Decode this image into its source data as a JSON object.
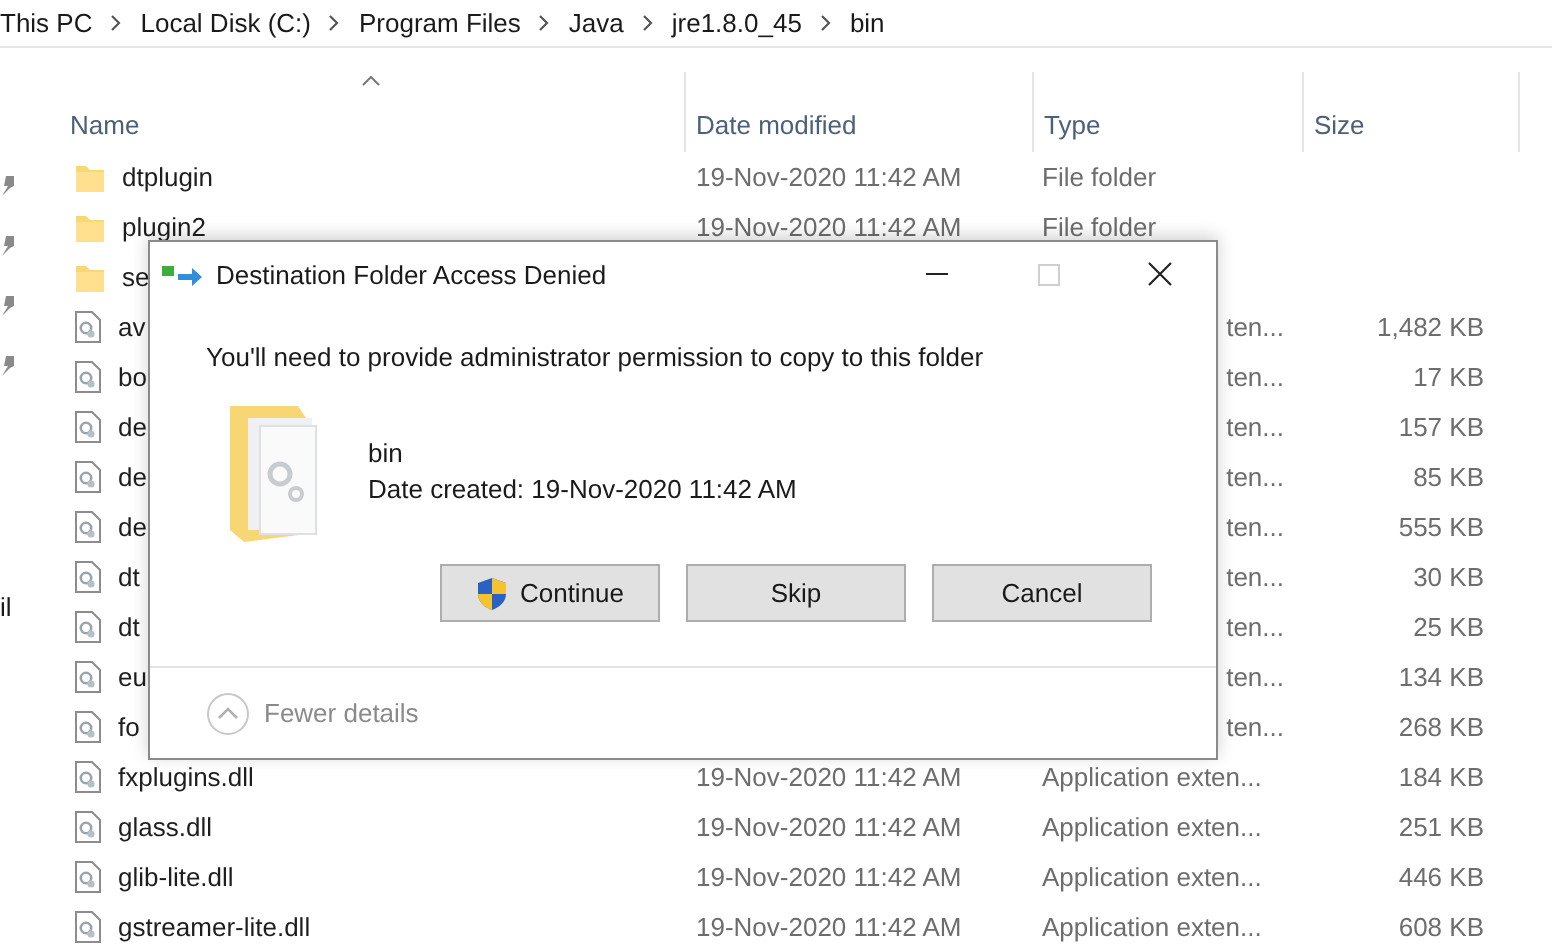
{
  "breadcrumb": [
    "This PC",
    "Local Disk (C:)",
    "Program Files",
    "Java",
    "jre1.8.0_45",
    "bin"
  ],
  "nav_pane": {
    "label": "il"
  },
  "columns": [
    {
      "label": "Name",
      "sorted": true
    },
    {
      "label": "Date modified",
      "sorted": false
    },
    {
      "label": "Type",
      "sorted": false
    },
    {
      "label": "Size",
      "sorted": false
    }
  ],
  "rows": [
    {
      "kind": "folder",
      "name": "dtplugin",
      "date": "19-Nov-2020 11:42 AM",
      "type": "File folder"
    },
    {
      "kind": "folder",
      "name": "plugin2",
      "date": "19-Nov-2020 11:42 AM",
      "type": "File folder"
    },
    {
      "kind": "folder",
      "name": "se"
    },
    {
      "kind": "file",
      "name": "av",
      "type_fragment": "ten...",
      "size": "1,482 KB"
    },
    {
      "kind": "file",
      "name": "bo",
      "type_fragment": "ten...",
      "size": "17 KB"
    },
    {
      "kind": "file",
      "name": "de",
      "type_fragment": "ten...",
      "size": "157 KB"
    },
    {
      "kind": "file",
      "name": "de",
      "type_fragment": "ten...",
      "size": "85 KB"
    },
    {
      "kind": "file",
      "name": "de",
      "type_fragment": "ten...",
      "size": "555 KB"
    },
    {
      "kind": "file",
      "name": "dt",
      "type_fragment": "ten...",
      "size": "30 KB"
    },
    {
      "kind": "file",
      "name": "dt",
      "type_fragment": "ten...",
      "size": "25 KB"
    },
    {
      "kind": "file",
      "name": "eu",
      "type_fragment": "ten...",
      "size": "134 KB"
    },
    {
      "kind": "file",
      "name": "fo",
      "type_fragment": "ten...",
      "size": "268 KB"
    },
    {
      "kind": "file",
      "name": "fxplugins.dll",
      "date": "19-Nov-2020 11:42 AM",
      "type": "Application exten...",
      "size": "184 KB"
    },
    {
      "kind": "file",
      "name": "glass.dll",
      "date": "19-Nov-2020 11:42 AM",
      "type": "Application exten...",
      "size": "251 KB"
    },
    {
      "kind": "file",
      "name": "glib-lite.dll",
      "date": "19-Nov-2020 11:42 AM",
      "type": "Application exten...",
      "size": "446 KB"
    },
    {
      "kind": "file",
      "name": "gstreamer-lite.dll",
      "date": "19-Nov-2020 11:42 AM",
      "type": "Application exten...",
      "size": "608 KB"
    }
  ],
  "dialog": {
    "title": "Destination Folder Access Denied",
    "title_buttons": [
      {
        "kind": "minimize",
        "disabled": false
      },
      {
        "kind": "maximize",
        "disabled": true
      },
      {
        "kind": "close",
        "disabled": false
      }
    ],
    "message": "You'll need to provide administrator permission to copy to this folder",
    "item": {
      "name": "bin",
      "detail": "Date created: 19-Nov-2020 11:42 AM"
    },
    "buttons": [
      {
        "label": "Continue",
        "shield": true
      },
      {
        "label": "Skip",
        "shield": false
      },
      {
        "label": "Cancel",
        "shield": false
      }
    ],
    "details_toggle": {
      "label": "Fewer details",
      "expanded": true
    }
  }
}
